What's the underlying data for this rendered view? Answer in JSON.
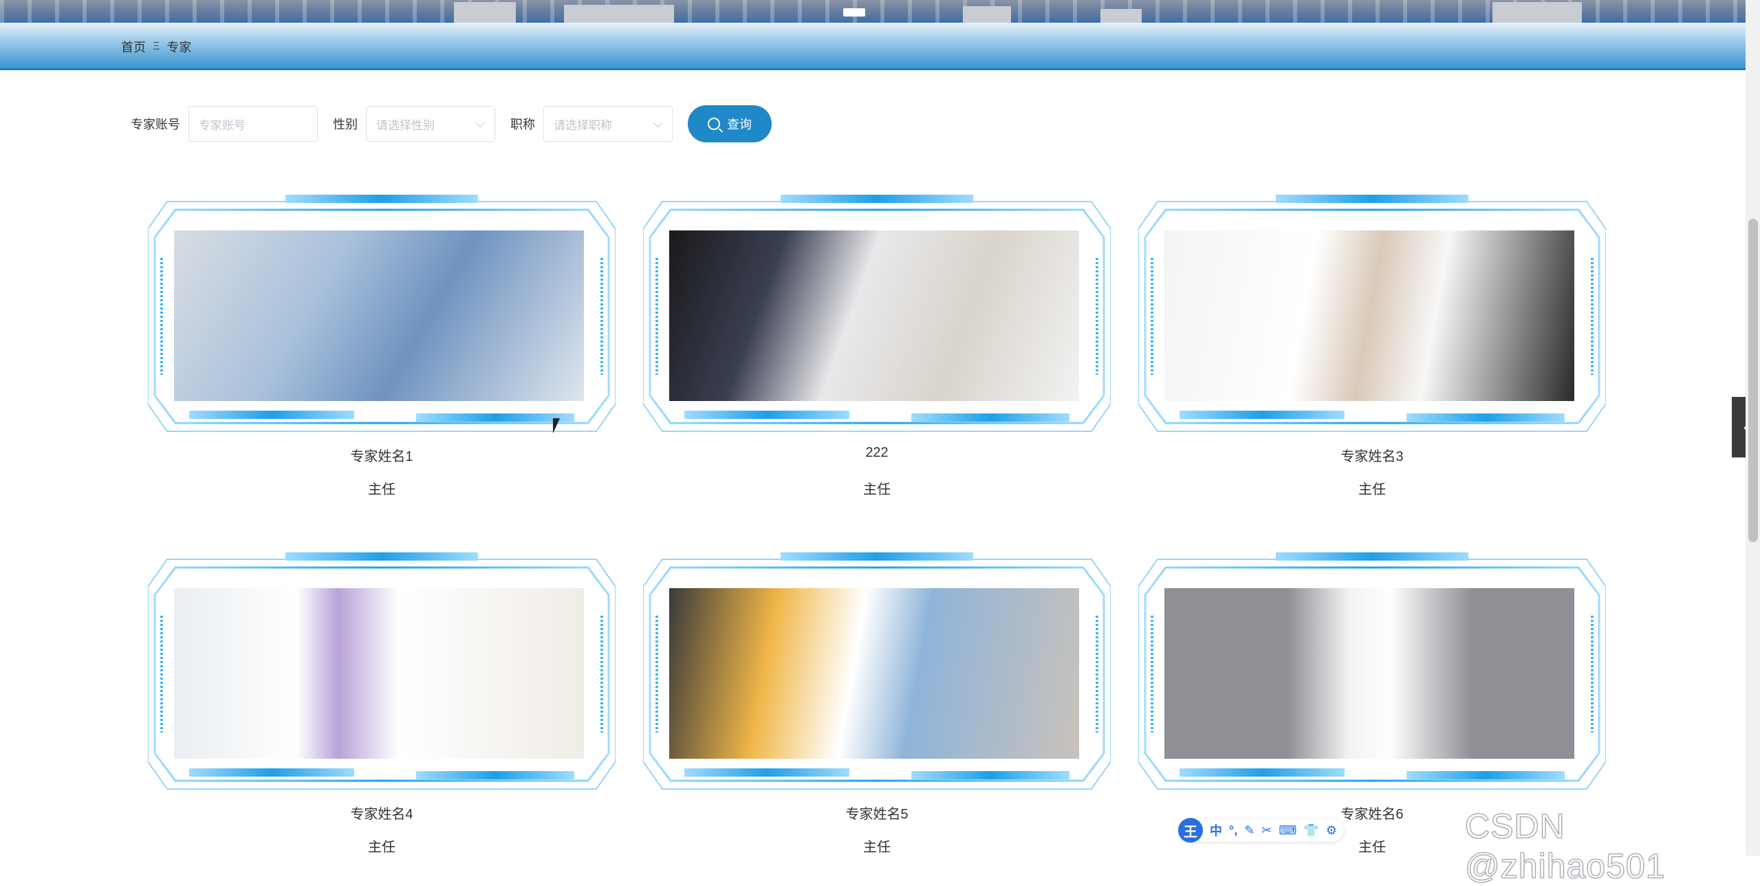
{
  "breadcrumb": {
    "home": "首页",
    "separator": "Ξ",
    "current": "专家"
  },
  "search": {
    "account_label": "专家账号",
    "account_placeholder": "专家账号",
    "gender_label": "性别",
    "gender_placeholder": "请选择性别",
    "title_label": "职称",
    "title_placeholder": "请选择职称",
    "query_button": "查询"
  },
  "experts": [
    {
      "name": "专家姓名1",
      "title": "主任"
    },
    {
      "name": "222",
      "title": "主任"
    },
    {
      "name": "专家姓名3",
      "title": "主任"
    },
    {
      "name": "专家姓名4",
      "title": "主任"
    },
    {
      "name": "专家姓名5",
      "title": "主任"
    },
    {
      "name": "专家姓名6",
      "title": "主任"
    }
  ],
  "ime": {
    "logo": "王",
    "lang": "中"
  },
  "watermark": "CSDN @zhihao501",
  "colors": {
    "accent": "#1f88c9",
    "frame": "#2aa8ee",
    "header_bar": "#3a96d2"
  }
}
